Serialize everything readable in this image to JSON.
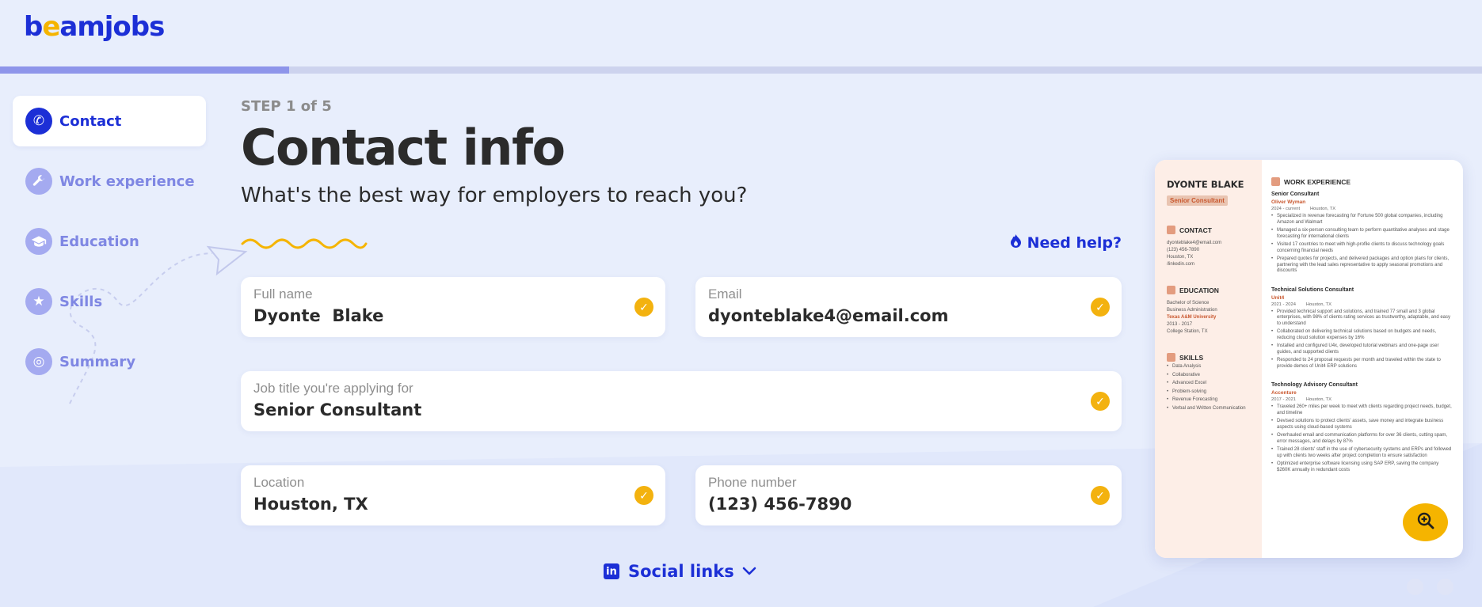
{
  "brand": {
    "logo_b": "b",
    "logo_e": "e",
    "logo_rest": "amjobs",
    "accent": "#1c2fd6",
    "highlight": "#f5b400"
  },
  "progress": {
    "fraction": 0.195
  },
  "sidebar": {
    "items": [
      {
        "label": "Contact",
        "icon": "phone-icon",
        "glyph": "✆",
        "active": true
      },
      {
        "label": "Work experience",
        "icon": "wrench-icon",
        "glyph": "🔧",
        "active": false
      },
      {
        "label": "Education",
        "icon": "graduation-cap-icon",
        "glyph": "🎓",
        "active": false
      },
      {
        "label": "Skills",
        "icon": "star-icon",
        "glyph": "★",
        "active": false
      },
      {
        "label": "Summary",
        "icon": "target-icon",
        "glyph": "◎",
        "active": false
      }
    ]
  },
  "main": {
    "step": "STEP 1 of 5",
    "title": "Contact info",
    "subtitle": "What's the best way for employers to reach you?",
    "need_help": "Need help?",
    "social_links": "Social links"
  },
  "form": {
    "full_name": {
      "label": "Full name",
      "value": "Dyonte  Blake"
    },
    "email": {
      "label": "Email",
      "value": "dyonteblake4@email.com"
    },
    "job_title": {
      "label": "Job title you're applying for",
      "value": "Senior Consultant"
    },
    "location": {
      "label": "Location",
      "value": "Houston, TX"
    },
    "phone": {
      "label": "Phone number",
      "value": "(123) 456-7890"
    }
  },
  "resume": {
    "name": "DYONTE BLAKE",
    "role": "Senior Consultant",
    "contact_heading": "CONTACT",
    "contact": [
      "dyonteblake4@email.com",
      "(123) 456-7890",
      "Houston, TX",
      "/linkedin.com"
    ],
    "education_heading": "EDUCATION",
    "education": {
      "degree": "Bachelor of Science",
      "major": "Business Administration",
      "school": "Texas A&M University",
      "dates": "2013 - 2017",
      "location": "College Station, TX"
    },
    "skills_heading": "SKILLS",
    "skills": [
      "Data Analysis",
      "Collaborative",
      "Advanced Excel",
      "Problem-solving",
      "Revenue Forecasting",
      "Verbal and Written Communication"
    ],
    "work_heading": "WORK EXPERIENCE",
    "jobs": [
      {
        "title": "Senior Consultant",
        "company": "Oliver Wyman",
        "dates": "2024 - current",
        "location": "Houston, TX",
        "bullets": [
          "Specialized in revenue forecasting for Fortune 500 global companies, including Amazon and Walmart",
          "Managed a six-person consulting team to perform quantitative analyses and stage forecasting for international clients",
          "Visited 17 countries to meet with high-profile clients to discuss technology goals concerning financial needs",
          "Prepared quotes for projects, and delivered packages and option plans for clients, partnering with the lead sales representative to apply seasonal promotions and discounts"
        ]
      },
      {
        "title": "Technical Solutions Consultant",
        "company": "Unit4",
        "dates": "2021 - 2024",
        "location": "Houston, TX",
        "bullets": [
          "Provided technical support and solutions, and trained 77 small and 3 global enterprises, with 98% of clients rating services as trustworthy, adaptable, and easy to understand",
          "Collaborated on delivering technical solutions based on budgets and needs, reducing cloud solution expenses by 16%",
          "Installed and configured U4x, developed tutorial webinars and one-page user guides, and supported clients",
          "Responded to 24 proposal requests per month and traveled within the state to provide demos of Unit4 ERP solutions"
        ]
      },
      {
        "title": "Technology Advisory Consultant",
        "company": "Accenture",
        "dates": "2017 - 2021",
        "location": "Houston, TX",
        "bullets": [
          "Traveled 260+ miles per week to meet with clients regarding project needs, budget, and timeline",
          "Devised solutions to protect clients' assets, save money and integrate business aspects using cloud-based systems",
          "Overhauled email and communication platforms for over 36 clients, cutting spam, error messages, and delays by 87%",
          "Trained 28 clients' staff in the use of cybersecurity systems and ERPs and followed up with clients two weeks after project completion to ensure satisfaction",
          "Optimized enterprise software licensing using SAP ERP, saving the company $260K annually in redundant costs"
        ]
      }
    ],
    "zoom_icon": "zoom-in-icon"
  }
}
